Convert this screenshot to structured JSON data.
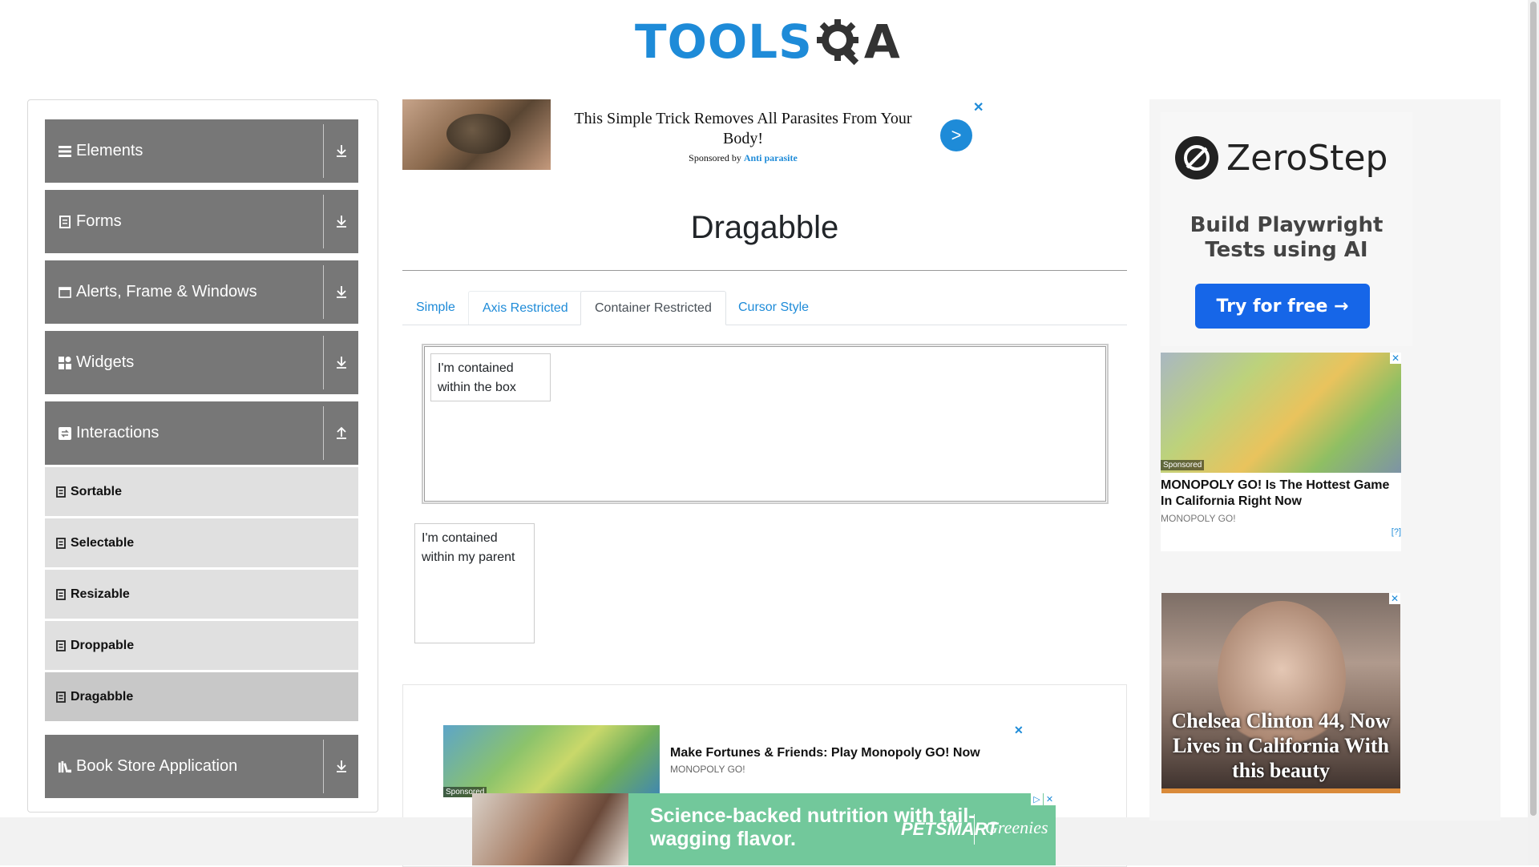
{
  "header": {
    "logo_tools": "TOOLS",
    "logo_a": "A"
  },
  "sidebar": {
    "groups": [
      {
        "label": "Elements",
        "icon": "hamburger-icon"
      },
      {
        "label": "Forms",
        "icon": "document-icon"
      },
      {
        "label": "Alerts, Frame & Windows",
        "icon": "window-icon"
      },
      {
        "label": "Widgets",
        "icon": "grid-icon"
      },
      {
        "label": "Interactions",
        "icon": "interactions-icon"
      },
      {
        "label": "Book Store Application",
        "icon": "books-icon"
      }
    ],
    "interaction_items": [
      "Sortable",
      "Selectable",
      "Resizable",
      "Droppable",
      "Dragabble"
    ],
    "active_item": "Dragabble"
  },
  "top_ad": {
    "headline": "This Simple Trick Removes All Parasites From Your Body!",
    "sponsored_prefix": "Sponsored by",
    "sponsor": "Anti parasite",
    "go_label": ">",
    "close_label": "✕"
  },
  "main": {
    "title": "Dragabble",
    "tabs": [
      {
        "label": "Simple",
        "active": false
      },
      {
        "label": "Axis Restricted",
        "active": false
      },
      {
        "label": "Container Restricted",
        "active": true
      },
      {
        "label": "Cursor Style",
        "active": false
      }
    ],
    "box_text": "I'm contained within the box",
    "parent_text": "I'm contained within my parent"
  },
  "content_ad": {
    "headline": "Make Fortunes & Friends: Play Monopoly GO! Now",
    "source": "MONOPOLY GO!",
    "sponsored": "Sponsored",
    "close_label": "✕"
  },
  "right_ads": {
    "zerostep": {
      "name": "ZeroStep",
      "tagline": "Build Playwright Tests using AI",
      "button": "Try for free →"
    },
    "monopoly": {
      "headline": "MONOPOLY GO! Is The Hottest Game In California Right Now",
      "source": "MONOPOLY GO!",
      "sponsored": "Sponsored",
      "adchoices": "[?]"
    },
    "chelsea": {
      "caption": "Chelsea Clinton 44, Now Lives in California With this beauty"
    }
  },
  "bottom_banner": {
    "text": "Science-backed nutrition with tail-wagging flavor.",
    "brand1": "PETSMART",
    "brand2": "Greenies"
  },
  "colors": {
    "accent": "#1e8bd8",
    "sidebar_group": "#777777",
    "sidebar_item": "#e0e0e0",
    "sidebar_item_active": "#c8c8c8"
  }
}
